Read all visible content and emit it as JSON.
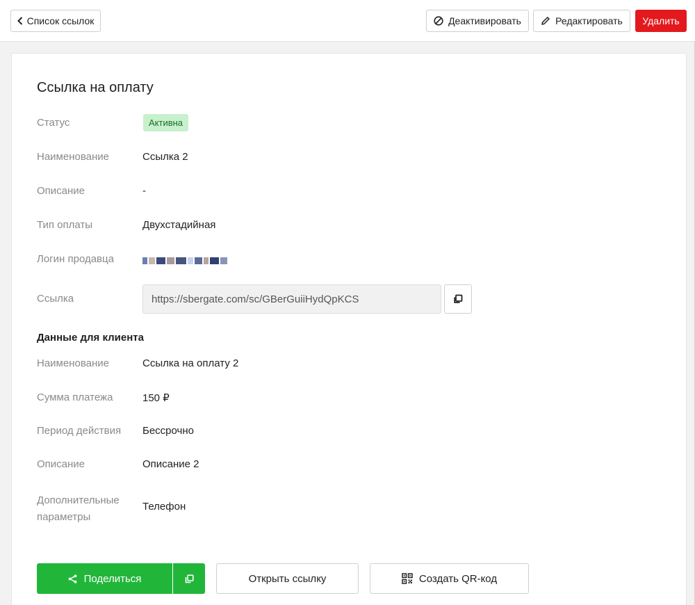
{
  "header": {
    "back_label": "Список ссылок",
    "deactivate_label": "Деактивировать",
    "edit_label": "Редактировать",
    "delete_label": "Удалить"
  },
  "card": {
    "title": "Ссылка на оплату",
    "fields": {
      "status": {
        "label": "Статус",
        "value": "Активна"
      },
      "name": {
        "label": "Наименование",
        "value": "Ссылка 2"
      },
      "description": {
        "label": "Описание",
        "value": "-"
      },
      "payment_type": {
        "label": "Тип оплаты",
        "value": "Двухстадийная"
      },
      "seller_login": {
        "label": "Логин продавца",
        "value": ""
      },
      "link": {
        "label": "Ссылка",
        "value": "https://sbergate.com/sc/GBerGuiiHydQpKCS"
      }
    },
    "client_section_title": "Данные для клиента",
    "client_fields": {
      "name": {
        "label": "Наименование",
        "value": "Ссылка на оплату 2"
      },
      "amount": {
        "label": "Сумма платежа",
        "value": "150 ₽"
      },
      "period": {
        "label": "Период действия",
        "value": "Бессрочно"
      },
      "description": {
        "label": "Описание",
        "value": "Описание 2"
      },
      "extra_params": {
        "label_line1": "Дополнительные",
        "label_line2": "параметры",
        "value": "Телефон"
      }
    }
  },
  "actions": {
    "share_label": "Поделиться",
    "open_label": "Открыть ссылку",
    "qr_label": "Создать QR-код"
  },
  "colors": {
    "primary_green": "#21b63a",
    "danger_red": "#e3191e",
    "status_badge_bg": "#c7f1cc",
    "status_badge_text": "#1b6b2a"
  }
}
